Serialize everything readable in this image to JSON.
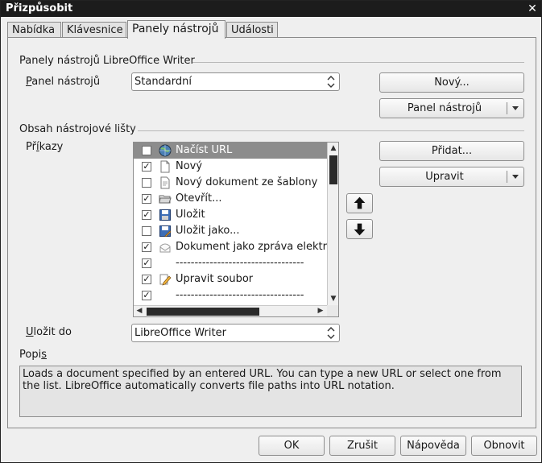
{
  "window": {
    "title": "Přizpůsobit"
  },
  "tabs": [
    {
      "label": "Nabídka"
    },
    {
      "label": "Klávesnice"
    },
    {
      "label": "Panely nástrojů"
    },
    {
      "label": "Události"
    }
  ],
  "toolbars_section": {
    "heading": "Panely nástrojů LibreOffice Writer",
    "toolbar_label": "Panel nástrojů",
    "toolbar_value": "Standardní",
    "new_button": "Nový...",
    "toolbar_menu_button": "Panel nástrojů"
  },
  "content_section": {
    "heading": "Obsah nástrojové lišty",
    "commands_label": "Příkazy",
    "add_button": "Přidat...",
    "modify_button": "Upravit",
    "commands": [
      {
        "label": "Načíst URL",
        "checked": false,
        "icon": "globe-icon",
        "selected": true
      },
      {
        "label": "Nový",
        "checked": true,
        "icon": "new-document-icon"
      },
      {
        "label": "Nový dokument ze šablony",
        "checked": false,
        "icon": "template-icon"
      },
      {
        "label": "Otevřít...",
        "checked": true,
        "icon": "open-folder-icon"
      },
      {
        "label": "Uložit",
        "checked": true,
        "icon": "save-icon"
      },
      {
        "label": "Uložit jako...",
        "checked": false,
        "icon": "save-as-icon"
      },
      {
        "label": "Dokument jako zpráva elektronické pošty...",
        "checked": true,
        "icon": "email-icon"
      },
      {
        "label": "----------------------------------",
        "checked": true,
        "icon": ""
      },
      {
        "label": "Upravit soubor",
        "checked": true,
        "icon": "edit-file-icon"
      },
      {
        "label": "----------------------------------",
        "checked": true,
        "icon": ""
      }
    ]
  },
  "save_in": {
    "label": "Uložit do",
    "value": "LibreOffice Writer"
  },
  "description": {
    "label": "Popis",
    "text": "Loads a document specified by an entered URL. You can type a new URL or select one from the list. LibreOffice automatically converts file paths into URL notation."
  },
  "footer": {
    "ok": "OK",
    "cancel": "Zrušit",
    "help": "Nápověda",
    "reset": "Obnovit"
  },
  "colors": {
    "titlebar": "#1c1c1c",
    "selection": "#8c8c8c",
    "background": "#efefef"
  }
}
